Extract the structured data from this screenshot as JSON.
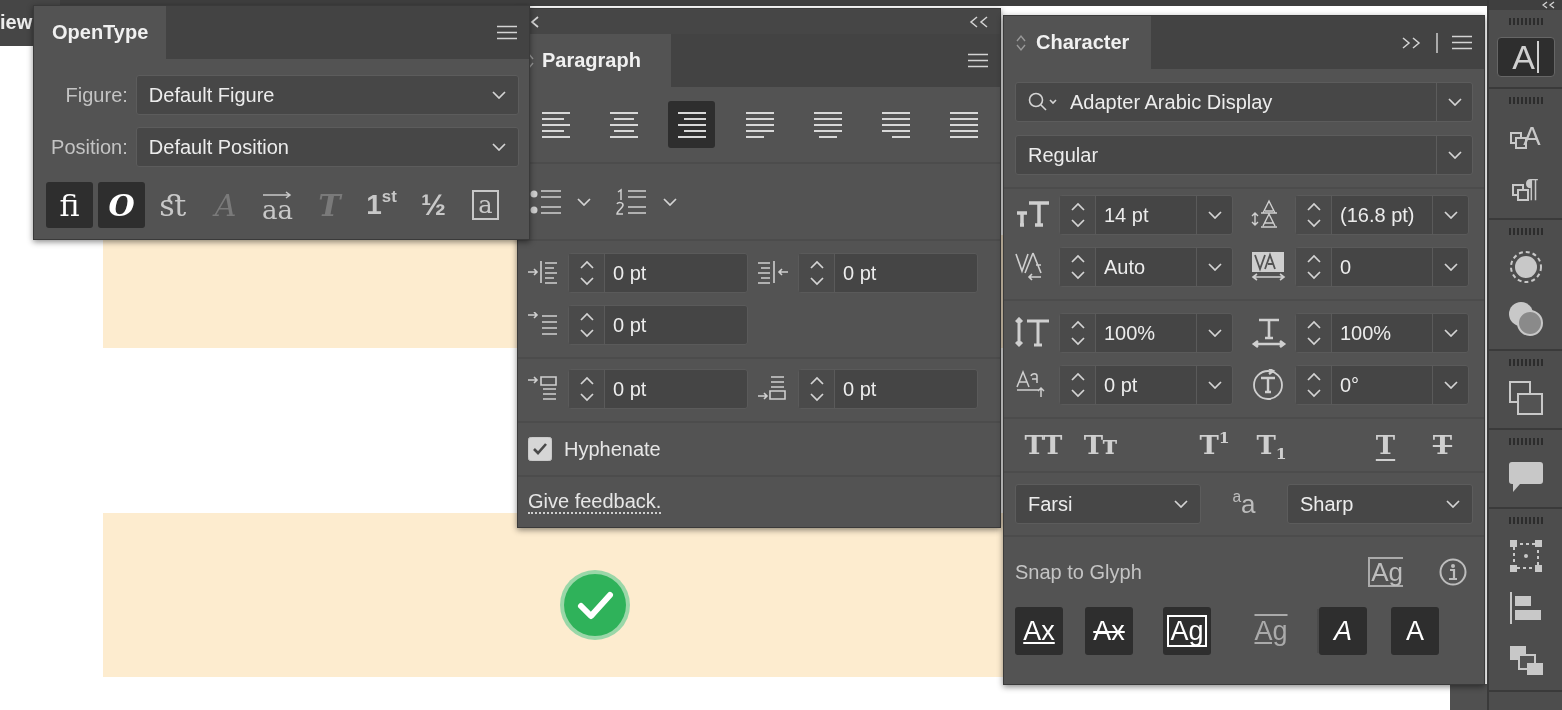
{
  "document_tab": {
    "label": "iew"
  },
  "opentype": {
    "title": "OpenType",
    "figure": {
      "label": "Figure:",
      "value": "Default Figure"
    },
    "position": {
      "label": "Position:",
      "value": "Default Position"
    },
    "features": [
      {
        "label": "ﬁ",
        "kind": "ligature",
        "selected": true,
        "disabled": false
      },
      {
        "label": "O",
        "kind": "swash",
        "selected": true,
        "disabled": false
      },
      {
        "label": "ﬆ",
        "kind": "discretionary",
        "selected": false,
        "disabled": false
      },
      {
        "label": "A",
        "kind": "stylistic",
        "selected": false,
        "disabled": true
      },
      {
        "label": "aa",
        "kind": "contextual",
        "selected": false,
        "disabled": false
      },
      {
        "label": "T",
        "kind": "titling",
        "selected": false,
        "disabled": true
      },
      {
        "label": "1$^{st}$",
        "kind": "ordinal",
        "selected": false,
        "disabled": false
      },
      {
        "label": "½",
        "kind": "fraction",
        "selected": false,
        "disabled": false
      },
      {
        "label": "a",
        "kind": "ornament",
        "selected": false,
        "disabled": false
      }
    ]
  },
  "paragraph": {
    "title": "Paragraph",
    "alignments": [
      {
        "selected": false
      },
      {
        "selected": false
      },
      {
        "selected": true
      },
      {
        "selected": false
      },
      {
        "selected": false
      },
      {
        "selected": false
      },
      {
        "selected": false
      }
    ],
    "indents": [
      {
        "value": "0 pt"
      },
      {
        "value": "0 pt"
      },
      {
        "value": "0 pt"
      },
      {
        "value": "0 pt"
      },
      {
        "value": "0 pt"
      }
    ],
    "hyphenate": {
      "label": "Hyphenate",
      "checked": true
    },
    "feedback": "Give feedback."
  },
  "character": {
    "title": "Character",
    "font_family": "Adapter Arabic Display",
    "font_style": "Regular",
    "metrics": [
      {
        "value": "14 pt"
      },
      {
        "value": "(16.8 pt)"
      },
      {
        "value": "Auto"
      },
      {
        "value": "0"
      },
      {
        "value": "100%"
      },
      {
        "value": "100%"
      },
      {
        "value": "0 pt"
      },
      {
        "value": "0°"
      }
    ],
    "type_styles": [
      {
        "label": "TT",
        "kind": "caps"
      },
      {
        "label": "Tᴛ",
        "kind": "small-caps"
      },
      {
        "label": "T$^{1}$",
        "kind": "super"
      },
      {
        "label": "T$_{1}$",
        "kind": "sub"
      },
      {
        "label": "T",
        "kind": "underline"
      },
      {
        "label": "T",
        "kind": "strike"
      }
    ],
    "language": "Farsi",
    "antialias_label": "$^{a}$a",
    "antialiasing": "Sharp",
    "snap_label": "Snap to Glyph",
    "snap_glyph_button": "Ag",
    "snap_options": [
      {
        "label": "Ax",
        "kind": "baseline",
        "selected": true
      },
      {
        "label": "Ax",
        "kind": "x-height",
        "selected": true
      },
      {
        "label": "Ag",
        "kind": "bounds",
        "selected": true
      },
      {
        "label": "Ag",
        "kind": "proximity",
        "selected": false
      },
      {
        "label": "A",
        "kind": "angular",
        "selected": true
      },
      {
        "label": "A",
        "kind": "anchor",
        "selected": true
      }
    ]
  },
  "toolbar": {
    "groups": [
      {
        "tools": [
          {
            "kind": "character",
            "label": "A",
            "selected": true
          }
        ]
      },
      {
        "tools": [
          {
            "kind": "character-styles",
            "label": "A",
            "selected": false
          },
          {
            "kind": "paragraph-styles",
            "label": "¶",
            "selected": false
          }
        ]
      },
      {
        "tools": [
          {
            "kind": "appearance",
            "selected": false
          },
          {
            "kind": "transparency",
            "selected": false
          }
        ]
      },
      {
        "tools": [
          {
            "kind": "pathfinder",
            "selected": false
          }
        ]
      },
      {
        "tools": [
          {
            "kind": "comments",
            "selected": false
          }
        ]
      },
      {
        "tools": [
          {
            "kind": "transform",
            "selected": false
          },
          {
            "kind": "align",
            "selected": false
          },
          {
            "kind": "arrange",
            "selected": false
          }
        ]
      }
    ]
  }
}
